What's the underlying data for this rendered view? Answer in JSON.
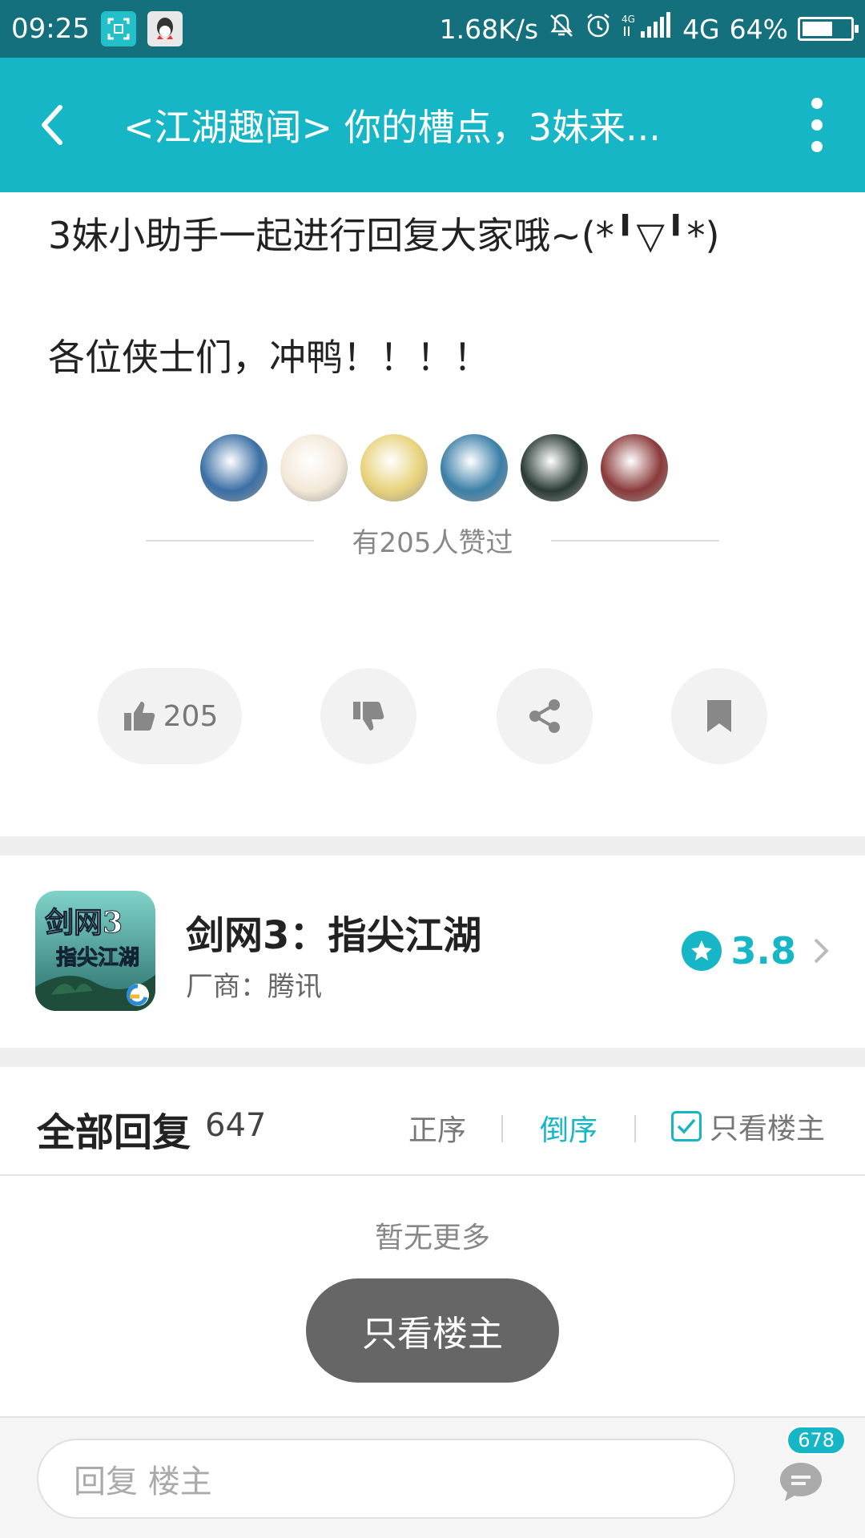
{
  "status_bar": {
    "time": "09:25",
    "speed": "1.68K/s",
    "network_label": "4G",
    "battery": "64%",
    "battery_level": 0.64
  },
  "app_bar": {
    "title": "<江湖趣闻> 你的槽点，3妹来..."
  },
  "post": {
    "line1": "3妹小助手一起进行回复大家哦~(*╹▽╹*)",
    "line2": "各位侠士们，冲鸭！！！！"
  },
  "likes": {
    "summary": "有205人赞过",
    "avatar_colors": [
      "#3a6fa5",
      "#f3e8d8",
      "#e8d27a",
      "#3b7fa8",
      "#2a3a35",
      "#8a3a3a"
    ]
  },
  "actions": {
    "like_count": "205"
  },
  "game": {
    "name": "剑网3：指尖江湖",
    "vendor": "厂商：腾讯",
    "rating": "3.8",
    "icon_logo_text": "剑网3 指尖江湖"
  },
  "replies": {
    "title": "全部回复",
    "count": "647",
    "sort_asc": "正序",
    "sort_desc": "倒序",
    "op_only_label": "只看楼主",
    "no_more": "暂无更多",
    "op_only_button": "只看楼主"
  },
  "bottom_bar": {
    "placeholder": "回复  楼主",
    "comment_count": "678"
  },
  "colors": {
    "accent": "#16b6c6",
    "status_bar": "#14707c"
  }
}
